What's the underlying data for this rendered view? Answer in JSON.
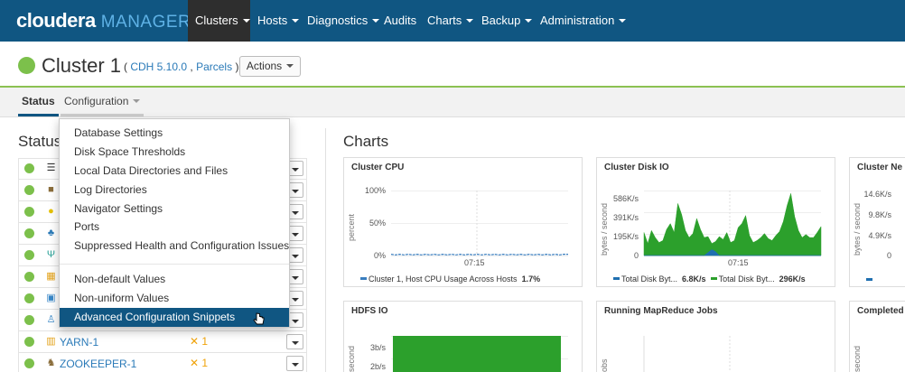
{
  "app": {
    "logo_primary": "cloudera",
    "logo_secondary": "MANAGER"
  },
  "nav": {
    "items": [
      {
        "label": "Clusters",
        "has_caret": true,
        "active": true
      },
      {
        "label": "Hosts",
        "has_caret": true
      },
      {
        "label": "Diagnostics",
        "has_caret": true
      },
      {
        "label": "Audits",
        "has_caret": false
      },
      {
        "label": "Charts",
        "has_caret": true
      },
      {
        "label": "Backup",
        "has_caret": true
      },
      {
        "label": "Administration",
        "has_caret": true
      }
    ]
  },
  "cluster": {
    "name": "Cluster 1",
    "paren_open": "(",
    "version_link": "CDH 5.10.0",
    "separator": ",",
    "parcels_link": "Parcels",
    "paren_close": ")",
    "actions_label": "Actions",
    "status_color": "#7cc04b"
  },
  "subtabs": {
    "status": "Status",
    "configuration": "Configuration"
  },
  "status_section": {
    "title": "Status",
    "services": [
      {
        "icon": "list-icon",
        "name": "",
        "warning": ""
      },
      {
        "icon": "hdfs-icon",
        "name": "",
        "warning": ""
      },
      {
        "icon": "hive-icon",
        "name": "",
        "warning": ""
      },
      {
        "icon": "hue-icon",
        "name": "",
        "warning": ""
      },
      {
        "icon": "fork-icon",
        "name": "",
        "warning": ""
      },
      {
        "icon": "grid-icon",
        "name": "",
        "warning": ""
      },
      {
        "icon": "oozie-icon",
        "name": "",
        "warning": ""
      },
      {
        "icon": "person-icon",
        "name": "",
        "warning": ""
      },
      {
        "icon": "yarn-icon",
        "name": "YARN-1",
        "warning": "1"
      },
      {
        "icon": "zookeeper-icon",
        "name": "ZOOKEEPER-1",
        "warning": "1"
      }
    ]
  },
  "config_menu": {
    "group1": [
      "Database Settings",
      "Disk Space Thresholds",
      "Local Data Directories and Files",
      "Log Directories",
      "Navigator Settings",
      "Ports",
      "Suppressed Health and Configuration Issues"
    ],
    "group2": [
      "Non-default Values",
      "Non-uniform Values",
      "Advanced Configuration Snippets"
    ],
    "highlighted": "Advanced Configuration Snippets"
  },
  "charts_section": {
    "title": "Charts"
  },
  "chart_data": [
    {
      "type": "line",
      "title": "Cluster CPU",
      "ylabel": "percent",
      "yticks": [
        "100%",
        "50%",
        "0%"
      ],
      "xticks": [
        "07:15"
      ],
      "ylim": [
        0,
        100
      ],
      "series": [
        {
          "name": "Cluster 1, Host CPU Usage Across Hosts",
          "color": "#3a7ebf",
          "values": [
            2,
            1,
            2,
            1,
            2,
            1,
            2,
            1,
            2,
            1,
            2,
            1,
            2,
            1,
            2,
            1,
            2,
            1,
            2,
            1,
            2,
            1,
            2,
            1,
            2,
            1,
            2,
            1,
            2,
            1,
            2,
            1,
            2,
            1,
            2,
            1,
            2,
            1,
            2,
            1,
            2,
            2
          ],
          "last": "1.7%"
        }
      ]
    },
    {
      "type": "area",
      "title": "Cluster Disk IO",
      "ylabel": "bytes / second",
      "yticks": [
        "586K/s",
        "391K/s",
        "195K/s",
        "0"
      ],
      "xticks": [
        "07:15"
      ],
      "ylim": [
        0,
        650
      ],
      "series": [
        {
          "name": "Total Disk Byt...",
          "color": "#1f6fb0",
          "values": [
            0,
            0,
            0,
            0,
            0,
            0,
            0,
            0,
            0,
            0,
            0,
            0,
            0,
            0,
            0,
            0,
            0,
            30,
            60,
            40,
            0,
            0,
            0,
            0,
            0,
            0,
            0,
            0,
            0,
            0,
            0,
            0,
            0,
            0,
            0,
            0,
            0,
            0,
            0,
            0,
            0,
            0,
            0,
            0,
            0,
            0,
            0,
            0
          ],
          "last": "6.8K/s"
        },
        {
          "name": "Total Disk Byt...",
          "color": "#2ca02c",
          "values": [
            230,
            120,
            250,
            180,
            130,
            150,
            260,
            320,
            230,
            520,
            410,
            250,
            180,
            220,
            370,
            260,
            180,
            190,
            120,
            140,
            190,
            160,
            230,
            130,
            150,
            280,
            320,
            400,
            200,
            130,
            150,
            180,
            220,
            170,
            150,
            200,
            240,
            340,
            500,
            620,
            390,
            250,
            180,
            210,
            180,
            180,
            230,
            290
          ],
          "last": "296K/s"
        }
      ]
    },
    {
      "type": "line",
      "title": "Cluster Ne",
      "ylabel": "bytes / second",
      "yticks": [
        "14.6K/s",
        "9.8K/s",
        "4.9K/s",
        "0"
      ],
      "series": []
    },
    {
      "type": "area",
      "title": "HDFS IO",
      "ylabel": "second",
      "yticks": [
        "3b/s",
        "2b/s"
      ],
      "series": [
        {
          "name": "",
          "color": "#2ca02c",
          "values": [
            4,
            4,
            4,
            4,
            4,
            4,
            4,
            4,
            4,
            4,
            4,
            4,
            4,
            4,
            4,
            4,
            4,
            4,
            4,
            4
          ]
        }
      ]
    },
    {
      "type": "line",
      "title": "Running MapReduce Jobs",
      "ylabel": "obs",
      "series": []
    },
    {
      "type": "line",
      "title": "Completed",
      "ylabel": "second",
      "series": []
    }
  ]
}
